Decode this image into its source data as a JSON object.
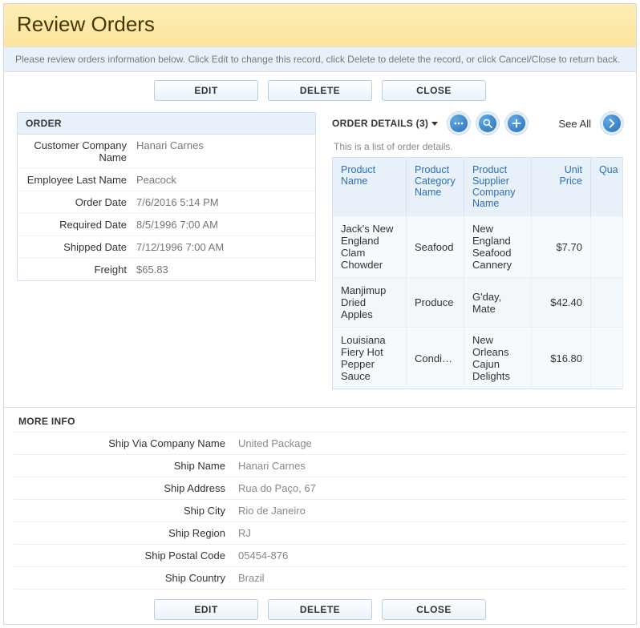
{
  "title": "Review Orders",
  "instructions": "Please review orders information below. Click Edit to change this record, click Delete to delete the record, or click Cancel/Close to return back.",
  "actions": {
    "edit": "EDIT",
    "delete": "DELETE",
    "close": "CLOSE"
  },
  "orderPanel": {
    "title": "ORDER",
    "rows": [
      {
        "label": "Customer Company Name",
        "value": "Hanari Carnes"
      },
      {
        "label": "Employee Last Name",
        "value": "Peacock"
      },
      {
        "label": "Order Date",
        "value": "7/6/2016 5:14 PM"
      },
      {
        "label": "Required Date",
        "value": "8/5/1996 7:00 AM"
      },
      {
        "label": "Shipped Date",
        "value": "7/12/1996 7:00 AM"
      },
      {
        "label": "Freight",
        "value": "$65.83"
      }
    ]
  },
  "details": {
    "title": "ORDER DETAILS (3)",
    "seeAll": "See All",
    "subtext": "This is a list of order details.",
    "columns": {
      "name": "Product Name",
      "category": "Product Category Name",
      "supplier": "Product Supplier Company Name",
      "price": "Unit Price",
      "qty": "Qua"
    },
    "rows": [
      {
        "name": "Jack's New England Clam Chowder",
        "category": "Seafood",
        "supplier": "New England Seafood Cannery",
        "price": "$7.70",
        "qty": ""
      },
      {
        "name": "Manjimup Dried Apples",
        "category": "Produce",
        "supplier": "G'day, Mate",
        "price": "$42.40",
        "qty": ""
      },
      {
        "name": "Louisiana Fiery Hot Pepper Sauce",
        "category": "Condim...",
        "supplier": "New Orleans Cajun Delights",
        "price": "$16.80",
        "qty": ""
      }
    ]
  },
  "moreInfo": {
    "title": "MORE INFO",
    "rows": [
      {
        "label": "Ship Via Company Name",
        "value": "United Package"
      },
      {
        "label": "Ship Name",
        "value": "Hanari Carnes"
      },
      {
        "label": "Ship Address",
        "value": "Rua do Paço, 67"
      },
      {
        "label": "Ship City",
        "value": "Rio de Janeiro"
      },
      {
        "label": "Ship Region",
        "value": "RJ"
      },
      {
        "label": "Ship Postal Code",
        "value": "05454-876"
      },
      {
        "label": "Ship Country",
        "value": "Brazil"
      }
    ]
  }
}
